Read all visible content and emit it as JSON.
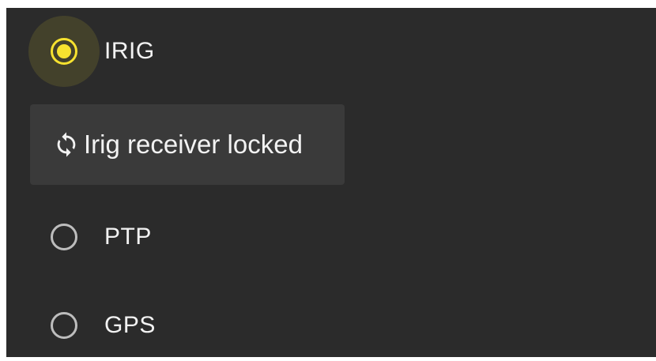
{
  "timing_sources": [
    {
      "label": "IRIG",
      "selected": true
    },
    {
      "label": "PTP",
      "selected": false
    },
    {
      "label": "GPS",
      "selected": false
    }
  ],
  "status": {
    "icon": "sync-icon",
    "text": "Irig receiver locked"
  },
  "colors": {
    "background": "#2b2b2b",
    "accent": "#f7e22f",
    "status_chip": "#3a3a3a",
    "text": "#f2f2f2",
    "radio_unchecked": "#bdbdbd"
  }
}
